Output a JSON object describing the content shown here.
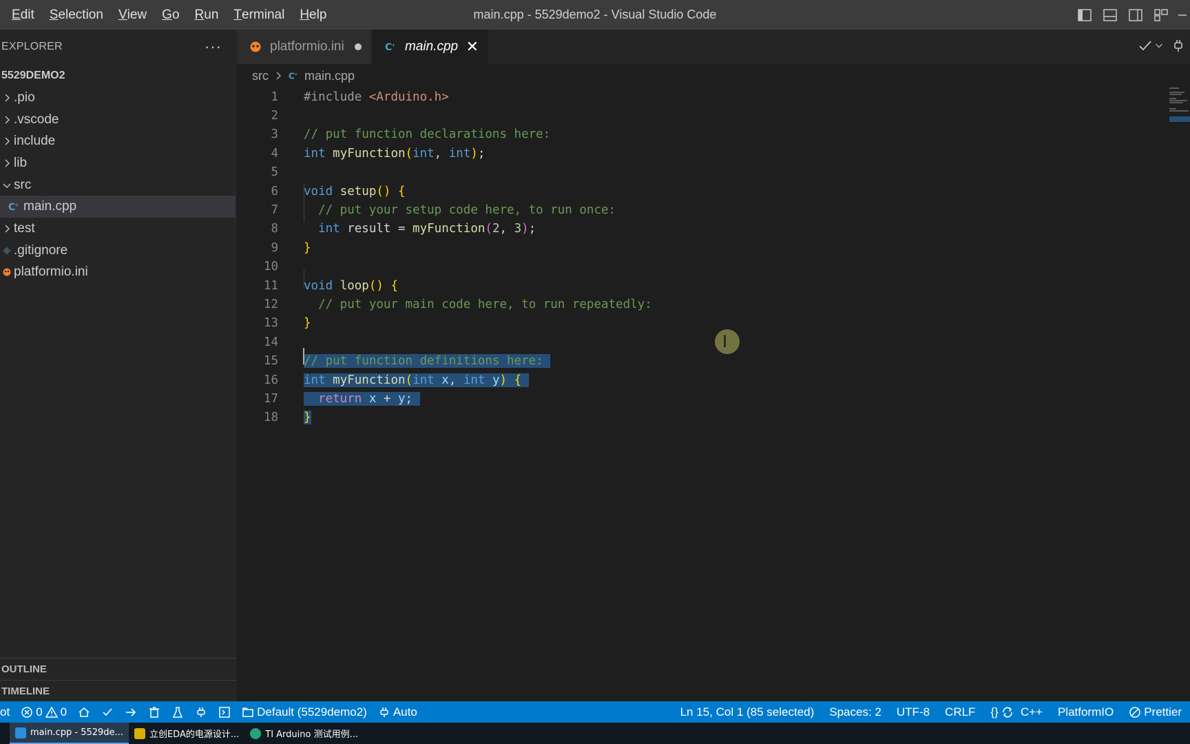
{
  "menu": [
    {
      "label": "Edit",
      "mnemonic": "E",
      "rest": "dit"
    },
    {
      "label": "Selection",
      "mnemonic": "S",
      "rest": "election"
    },
    {
      "label": "View",
      "mnemonic": "V",
      "rest": "iew"
    },
    {
      "label": "Go",
      "mnemonic": "G",
      "rest": "o"
    },
    {
      "label": "Run",
      "mnemonic": "R",
      "rest": "un"
    },
    {
      "label": "Terminal",
      "mnemonic": "T",
      "rest": "erminal"
    },
    {
      "label": "Help",
      "mnemonic": "H",
      "rest": "elp"
    }
  ],
  "window_title": "main.cpp - 5529demo2 - Visual Studio Code",
  "sidebar": {
    "title": "EXPLORER",
    "more": "···",
    "project": "5529DEMO2",
    "items": [
      {
        "label": ".pio",
        "kind": "folder",
        "expanded": false
      },
      {
        "label": ".vscode",
        "kind": "folder",
        "expanded": false
      },
      {
        "label": "include",
        "kind": "folder",
        "expanded": false
      },
      {
        "label": "lib",
        "kind": "folder",
        "expanded": false
      },
      {
        "label": "src",
        "kind": "folder",
        "expanded": true
      },
      {
        "label": "main.cpp",
        "kind": "cpp",
        "selected": true
      },
      {
        "label": "test",
        "kind": "folder",
        "expanded": false
      },
      {
        "label": ".gitignore",
        "kind": "git"
      },
      {
        "label": "platformio.ini",
        "kind": "platformio"
      }
    ],
    "outline": "OUTLINE",
    "timeline": "TIMELINE"
  },
  "tabs": [
    {
      "label": "platformio.ini",
      "active": false,
      "dirty": true
    },
    {
      "label": "main.cpp",
      "active": true,
      "close": "✕"
    }
  ],
  "breadcrumb": {
    "folder": "src",
    "file": "main.cpp"
  },
  "editor": {
    "line_numbers": [
      "1",
      "2",
      "3",
      "4",
      "5",
      "6",
      "7",
      "8",
      "9",
      "10",
      "11",
      "12",
      "13",
      "14",
      "15",
      "16",
      "17",
      "18"
    ]
  },
  "statusbar": {
    "left_fragment": "ot",
    "errors": "0",
    "warnings": "0",
    "env": "Default (5529demo2)",
    "port": "Auto",
    "position": "Ln 15, Col 1 (85 selected)",
    "spaces": "Spaces: 2",
    "encoding": "UTF-8",
    "eol": "CRLF",
    "braces": "{}",
    "language": "C++",
    "platformio": "PlatformIO",
    "prettier": "Prettier"
  },
  "taskbar": [
    {
      "label": "main.cpp - 5529de...",
      "active": true,
      "color": "#2a8fdc"
    },
    {
      "label": "立创EDA的电源设计...",
      "active": false,
      "color": "#d8b000"
    },
    {
      "label": "TI Arduino 测试用例...",
      "active": false,
      "color": "#1fa67a"
    }
  ],
  "colors": {
    "accent": "#007acc",
    "selection": "#264f78",
    "keyword": "#569cd6",
    "comment": "#6a9955",
    "function": "#dcdcaa",
    "bracket": "#ffd700",
    "platformio_orange": "#f5822a"
  }
}
